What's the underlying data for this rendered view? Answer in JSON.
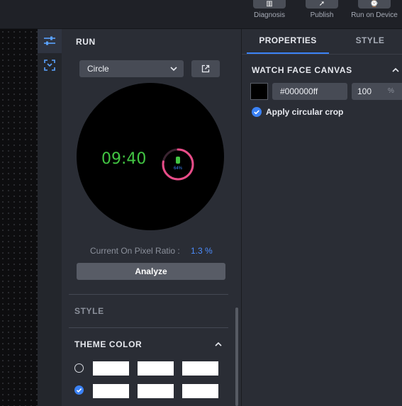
{
  "toolbar": {
    "buttons": [
      {
        "label": "Diagnosis",
        "icon": "diagnosis-icon"
      },
      {
        "label": "Publish",
        "icon": "publish-icon"
      },
      {
        "label": "Run on Device",
        "icon": "run-on-device-icon"
      }
    ]
  },
  "toolstrip": {
    "items": [
      {
        "icon": "sliders-icon",
        "active": true
      },
      {
        "icon": "focus-scan-icon",
        "active": false
      }
    ]
  },
  "run_panel": {
    "title": "RUN",
    "shape_select": {
      "value": "Circle"
    },
    "watch_face": {
      "time": "09:40",
      "battery_percent_label": "64%",
      "battery_level": 0.78,
      "ring_color": "#e84c88",
      "time_color": "#42c543"
    },
    "on_pixel_ratio": {
      "label": "Current On Pixel Ratio :",
      "value": "1.3 %"
    },
    "analyze_label": "Analyze",
    "style_label": "STYLE",
    "theme_color": {
      "title": "THEME COLOR",
      "rows": [
        {
          "selected": false,
          "swatches": [
            "#ffffff",
            "#ffffff",
            "#ffffff"
          ]
        },
        {
          "selected": true,
          "swatches": [
            "#ffffff",
            "#ffffff",
            "#ffffff"
          ]
        }
      ]
    }
  },
  "properties_panel": {
    "tabs": [
      {
        "label": "PROPERTIES",
        "active": true
      },
      {
        "label": "STYLE",
        "active": false
      }
    ],
    "canvas": {
      "title": "WATCH FACE CANVAS",
      "color_hex": "#000000ff",
      "opacity": "100",
      "opacity_unit": "%",
      "circular_crop_label": "Apply circular crop",
      "circular_crop_checked": true
    }
  },
  "colors": {
    "accent": "#3b82f6",
    "panel_bg": "#2a2d35",
    "button_bg": "#474b55"
  }
}
